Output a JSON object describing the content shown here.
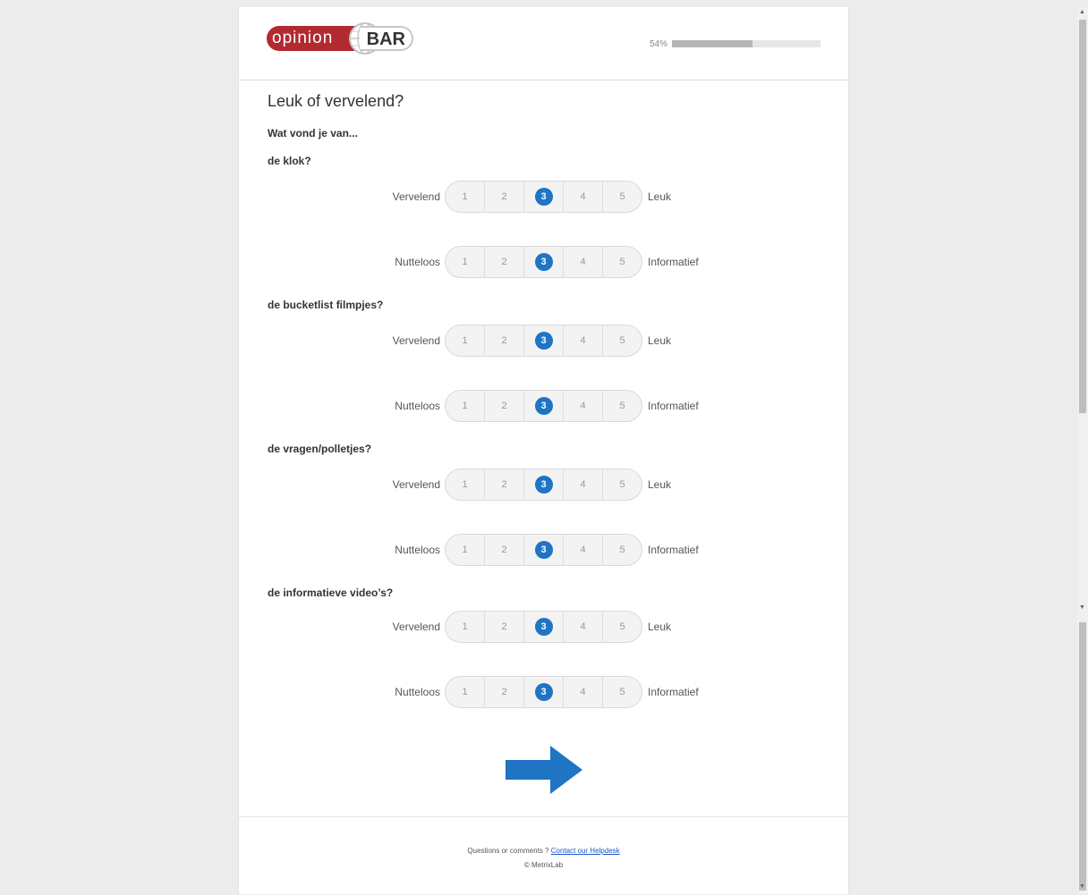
{
  "brand": {
    "logo_left": "opinion",
    "logo_right": "BAR"
  },
  "progress": {
    "label": "54%",
    "value": 0.54
  },
  "page_title": "Leuk of vervelend?",
  "intro": "Wat vond je van...",
  "questions": [
    {
      "label": "de klok?",
      "scales": [
        {
          "left": "Vervelend",
          "right": "Leuk",
          "options": [
            "1",
            "2",
            "3",
            "4",
            "5"
          ],
          "selected": "3"
        },
        {
          "left": "Nutteloos",
          "right": "Informatief",
          "options": [
            "1",
            "2",
            "3",
            "4",
            "5"
          ],
          "selected": "3"
        }
      ]
    },
    {
      "label": "de bucketlist filmpjes?",
      "scales": [
        {
          "left": "Vervelend",
          "right": "Leuk",
          "options": [
            "1",
            "2",
            "3",
            "4",
            "5"
          ],
          "selected": "3"
        },
        {
          "left": "Nutteloos",
          "right": "Informatief",
          "options": [
            "1",
            "2",
            "3",
            "4",
            "5"
          ],
          "selected": "3"
        }
      ]
    },
    {
      "label": "de vragen/polletjes?",
      "scales": [
        {
          "left": "Vervelend",
          "right": "Leuk",
          "options": [
            "1",
            "2",
            "3",
            "4",
            "5"
          ],
          "selected": "3"
        },
        {
          "left": "Nutteloos",
          "right": "Informatief",
          "options": [
            "1",
            "2",
            "3",
            "4",
            "5"
          ],
          "selected": "3"
        }
      ]
    },
    {
      "label": "de informatieve video’s?",
      "scales": [
        {
          "left": "Vervelend",
          "right": "Leuk",
          "options": [
            "1",
            "2",
            "3",
            "4",
            "5"
          ],
          "selected": "3"
        },
        {
          "left": "Nutteloos",
          "right": "Informatief",
          "options": [
            "1",
            "2",
            "3",
            "4",
            "5"
          ],
          "selected": "3"
        }
      ]
    }
  ],
  "next_button": {
    "icon": "arrow-right-icon",
    "color": "#1f74c4"
  },
  "footer": {
    "text": "Questions or comments ?",
    "link": "Contact our Helpdesk",
    "copyright": "© MetrixLab"
  }
}
